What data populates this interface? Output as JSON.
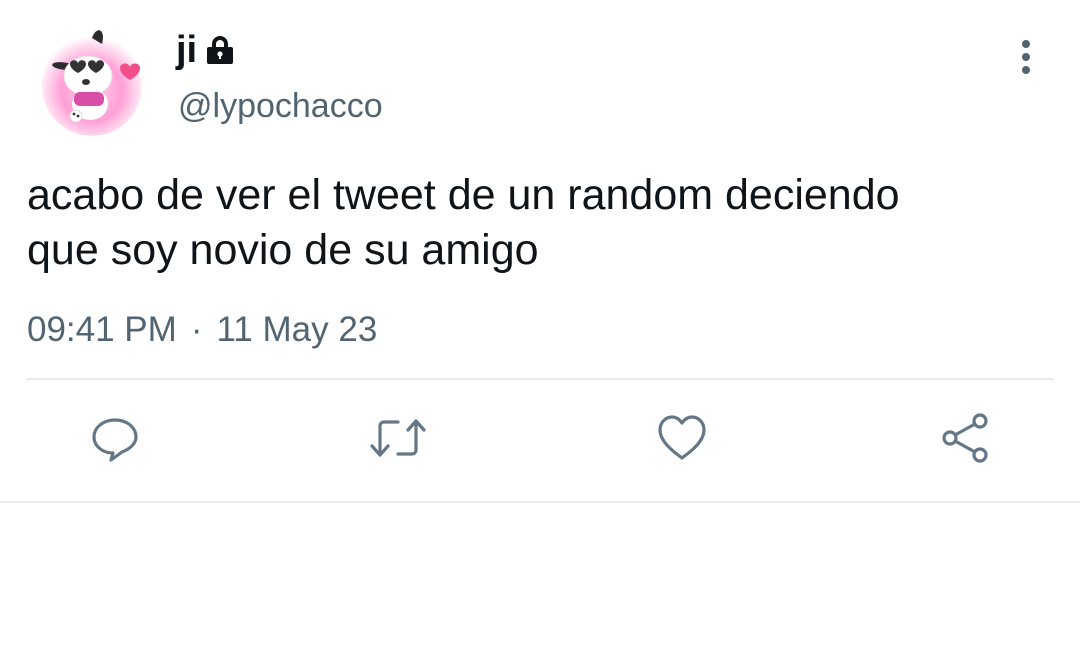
{
  "tweet": {
    "display_name": "ji",
    "handle": "@lypochacco",
    "text": "acabo de ver el tweet de un random deciendo\nque soy novio de su amigo",
    "time": "09:41 PM",
    "separator": "·",
    "date": "11 May 23",
    "protected_icon": "lock-icon",
    "more_icon": "vertical-dots-icon"
  },
  "actions": [
    {
      "icon": "reply-icon"
    },
    {
      "icon": "retweet-icon"
    },
    {
      "icon": "like-icon"
    },
    {
      "icon": "share-icon"
    }
  ],
  "colors": {
    "text_primary": "#0f1419",
    "text_secondary": "#536471",
    "icon_gray": "#657786",
    "divider": "#e6ecf0"
  }
}
